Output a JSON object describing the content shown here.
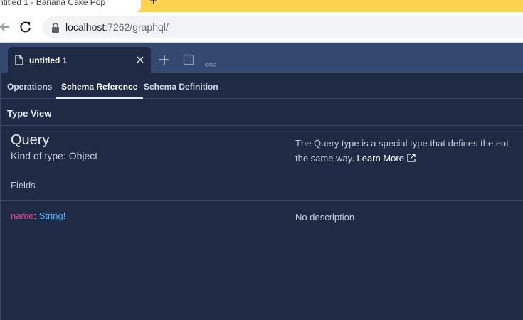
{
  "browser": {
    "tab_title": "ntitled 1 - Banana Cake Pop",
    "new_tab_label": "+",
    "url_host": "localhost",
    "url_rest": ":7262/graphql/"
  },
  "app": {
    "doc_tab_title": "untitled 1",
    "view_tabs": [
      {
        "label": "Operations",
        "active": false
      },
      {
        "label": "Schema Reference",
        "active": true
      },
      {
        "label": "Schema Definition",
        "active": false
      }
    ],
    "type_view_label": "Type View",
    "type": {
      "name": "Query",
      "kind": "Kind of type: Object",
      "description_line1": "The Query type is a special type that defines the ent",
      "description_line2": "the same way.",
      "learn_more": "Learn More"
    },
    "fields_label": "Fields",
    "fields": [
      {
        "name": "name",
        "separator": ": ",
        "type": "String",
        "suffix": "!",
        "description": "No description"
      }
    ]
  },
  "colors": {
    "chrome_tab_strip": "#fcd34d",
    "app_background": "#1f2a44",
    "doc_tabbar": "#34496f",
    "field_name": "#f542a7",
    "field_type": "#4fb3ff"
  },
  "icons": [
    "back-arrow-icon",
    "reload-icon",
    "lock-icon",
    "file-icon",
    "close-icon",
    "plus-icon",
    "save-icon",
    "more-icon",
    "external-link-icon"
  ]
}
